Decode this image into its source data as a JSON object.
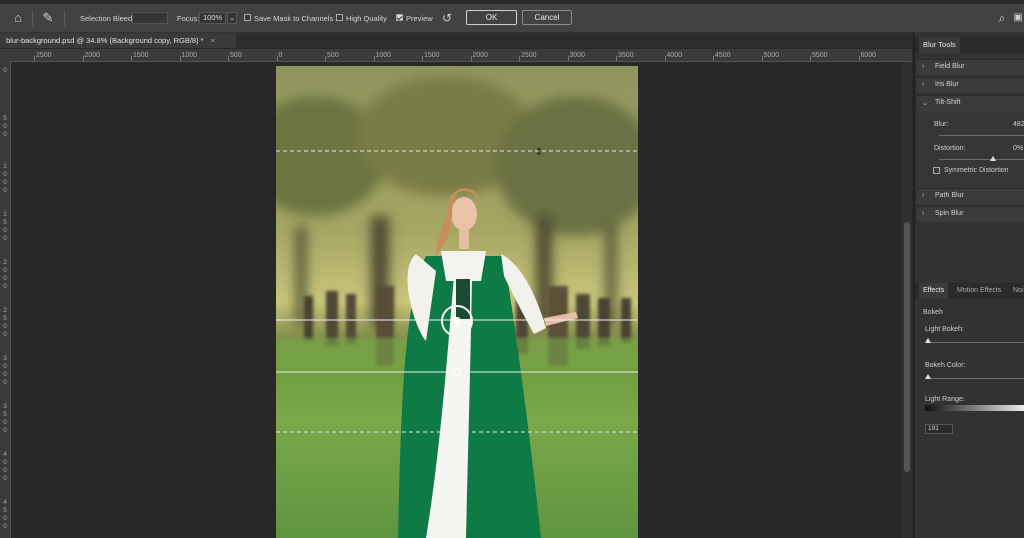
{
  "options_bar": {
    "home_icon": "home-icon",
    "tool_icon": "pin-icon",
    "selection_bleed_label": "Selection Bleed:",
    "selection_bleed_value": "",
    "focus_label": "Focus:",
    "focus_value": "100%",
    "save_mask_label": "Save Mask to Channels",
    "save_mask_checked": false,
    "high_quality_label": "High Quality",
    "high_quality_checked": false,
    "preview_label": "Preview",
    "preview_checked": true,
    "ok_label": "OK",
    "cancel_label": "Cancel"
  },
  "document": {
    "tab_title": "blur-background.psd @ 34.8% (Background copy, RGB/8) *",
    "close_glyph": "×"
  },
  "ruler": {
    "top_ticks": [
      "2500",
      "2000",
      "1500",
      "1000",
      "500",
      "0",
      "500",
      "1000",
      "1500",
      "2000",
      "2500",
      "3000",
      "3500",
      "4000",
      "4500",
      "5000",
      "5500",
      "6000"
    ],
    "left_ticks": [
      "0",
      "5\n0\n0",
      "1\n0\n0\n0",
      "1\n5\n0\n0",
      "2\n0\n0\n0",
      "2\n5\n0\n0",
      "3\n0\n0\n0",
      "3\n5\n0\n0",
      "4\n0\n0\n0",
      "4\n5\n0\n0"
    ]
  },
  "blur_panel": {
    "title": "Blur Tools",
    "sections": [
      {
        "label": "Field Blur",
        "expanded": false
      },
      {
        "label": "Iris Blur",
        "expanded": false
      },
      {
        "label": "Tilt-Shift",
        "expanded": true
      },
      {
        "label": "Path Blur",
        "expanded": false
      },
      {
        "label": "Spin Blur",
        "expanded": false
      }
    ],
    "blur_label": "Blur:",
    "blur_value": "482",
    "distortion_label": "Distortion:",
    "distortion_value": "0%",
    "symmetric_label": "Symmetric Distortion",
    "symmetric_checked": false
  },
  "effects_panel": {
    "tabs": [
      "Effects",
      "Motion Effects",
      "Noise"
    ],
    "active_tab": "Effects",
    "bokeh_label": "Bokeh",
    "light_bokeh_label": "Light Bokeh:",
    "bokeh_color_label": "Bokeh Color:",
    "light_range_label": "Light Range:",
    "light_range_value": "191"
  },
  "colors": {
    "dress_green": "#0e7a45",
    "accent_white": "#ffffff"
  }
}
